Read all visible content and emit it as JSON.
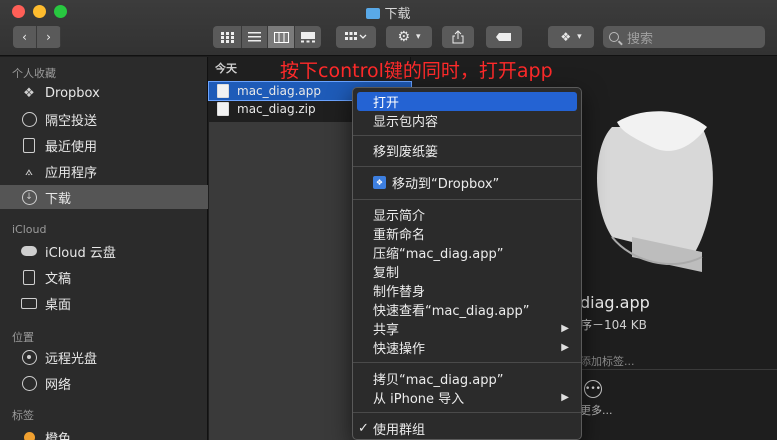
{
  "window": {
    "title": "下载"
  },
  "toolbar": {
    "back_label": "‹",
    "forward_label": "›",
    "action_label": "⚙",
    "search_placeholder": "搜索"
  },
  "sidebar": {
    "sections": [
      {
        "heading": "个人收藏",
        "items": [
          {
            "label": "Dropbox",
            "icon": "dropbox-icon"
          },
          {
            "label": "隔空投送",
            "icon": "airdrop-icon"
          },
          {
            "label": "最近使用",
            "icon": "recents-icon"
          },
          {
            "label": "应用程序",
            "icon": "applications-icon"
          },
          {
            "label": "下载",
            "icon": "downloads-icon",
            "selected": true
          }
        ]
      },
      {
        "heading": "iCloud",
        "items": [
          {
            "label": "iCloud 云盘",
            "icon": "cloud-icon"
          },
          {
            "label": "文稿",
            "icon": "document-icon"
          },
          {
            "label": "桌面",
            "icon": "desktop-icon"
          }
        ]
      },
      {
        "heading": "位置",
        "items": [
          {
            "label": "远程光盘",
            "icon": "disc-icon"
          },
          {
            "label": "网络",
            "icon": "network-icon"
          }
        ]
      },
      {
        "heading": "标签",
        "items": [
          {
            "label": "橙色",
            "icon": "tag-icon"
          }
        ]
      }
    ]
  },
  "files": {
    "group_heading": "今天",
    "items": [
      {
        "name": "mac_diag.app",
        "selected": true
      },
      {
        "name": "mac_diag.zip",
        "selected": false
      }
    ]
  },
  "annotation": "按下control键的同时，打开app",
  "preview": {
    "name": "diag.app",
    "info": "序－104 KB",
    "tag_hint": "添加标签...",
    "more_label": "更多..."
  },
  "context_menu": {
    "items": [
      {
        "label": "打开",
        "highlighted": true
      },
      {
        "label": "显示包内容"
      },
      {
        "separator": true
      },
      {
        "label": "移到废纸篓"
      },
      {
        "separator": true
      },
      {
        "label": "移动到“Dropbox”",
        "icon": "dropbox-icon"
      },
      {
        "separator": true
      },
      {
        "label": "显示简介"
      },
      {
        "label": "重新命名"
      },
      {
        "label": "压缩“mac_diag.app”"
      },
      {
        "label": "复制"
      },
      {
        "label": "制作替身"
      },
      {
        "label": "快速查看“mac_diag.app”"
      },
      {
        "label": "共享",
        "submenu": true
      },
      {
        "label": "快速操作",
        "submenu": true
      },
      {
        "separator": true
      },
      {
        "label": "拷贝“mac_diag.app”"
      },
      {
        "label": "从 iPhone 导入",
        "submenu": true
      },
      {
        "separator": true
      },
      {
        "label": "使用群组",
        "checked": true
      }
    ]
  }
}
